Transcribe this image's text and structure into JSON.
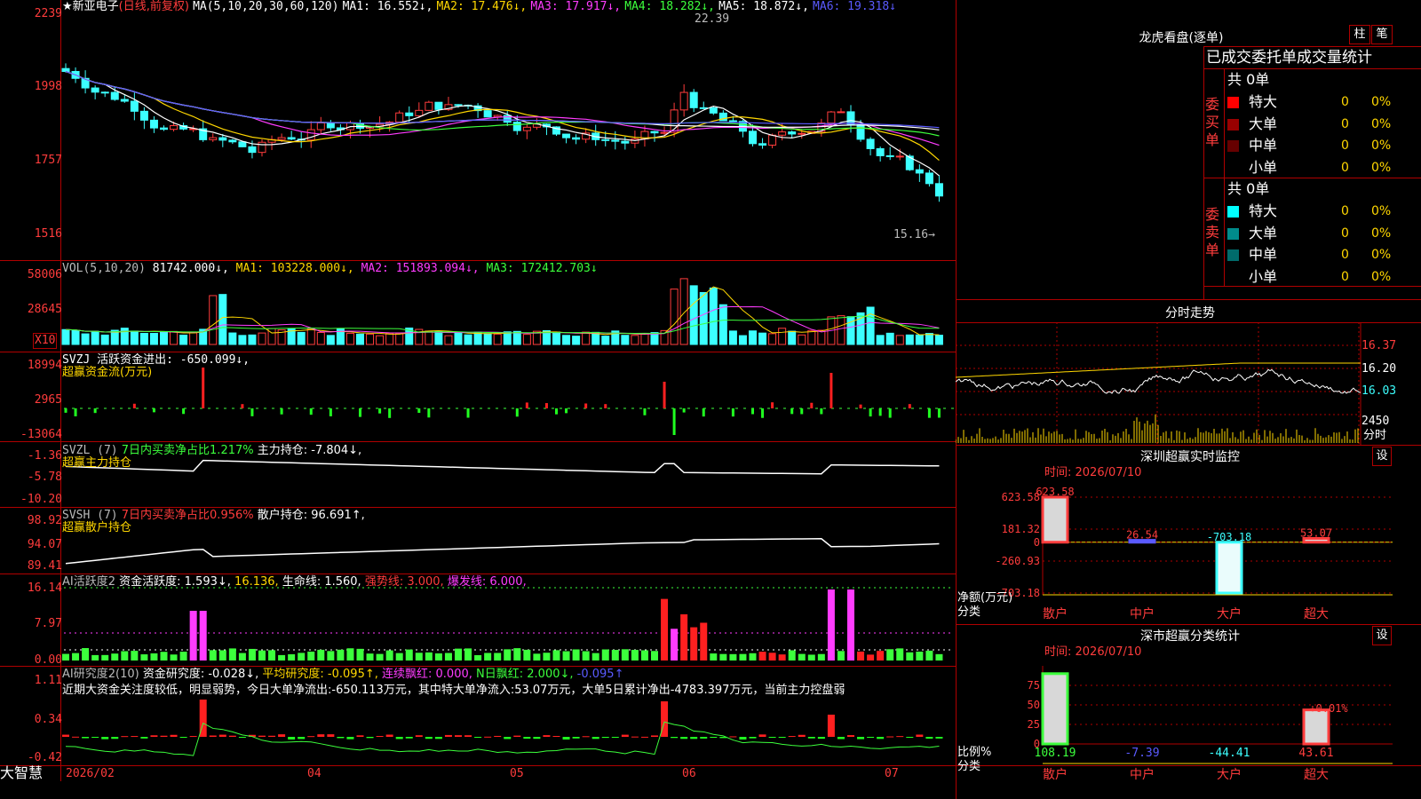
{
  "app": {
    "brand": "大智慧"
  },
  "kline": {
    "stock_name": "★新亚电子",
    "mode": "(日线,前复权)",
    "ma_header": "MA(5,10,20,30,60,120)",
    "ma1": "MA1: 16.552↓,",
    "ma2": "MA2: 17.476↓,",
    "ma3": "MA3: 17.917↓,",
    "ma4": "MA4: 18.282↓,",
    "ma5": "MA5: 18.872↓,",
    "ma6": "MA6: 19.318↓",
    "y_ticks": [
      "2239",
      "1998",
      "1757",
      "1516"
    ],
    "high_label": "22.39",
    "low_label": "15.16→"
  },
  "vol": {
    "header": "VOL(5,10,20)",
    "v": "81742.000↓,",
    "ma1": "MA1: 103228.000↓,",
    "ma2": "MA2: 151893.094↓,",
    "ma3": "MA3: 172412.703↓",
    "y_ticks": [
      "58006",
      "28645"
    ],
    "unit": "X10"
  },
  "svzj": {
    "header": "SVZJ  活跃资金进出: -650.099↓,",
    "sub": "超赢资金流(万元)",
    "y_ticks": [
      "18994",
      "2965",
      "-13064"
    ]
  },
  "svzl": {
    "header": "SVZL (7)",
    "desc": "7日内买卖净占比1.217%",
    "value": "主力持仓: -7.804↓,",
    "sub": "超赢主力持仓",
    "y_ticks": [
      "-1.36",
      "-5.78",
      "-10.20"
    ]
  },
  "svsh": {
    "header": "SVSH (7)",
    "desc": "7日内买卖净占比0.956%",
    "value": "散户持仓: 96.691↑,",
    "sub": "超赢散户持仓",
    "y_ticks": [
      "98.92",
      "94.07",
      "89.41"
    ]
  },
  "ai1": {
    "header": "AI活跃度2",
    "v1": "资金活跃度: 1.593↓,",
    "v2": "16.136,",
    "v3": "生命线: 1.560,",
    "v4": "强势线: 3.000,",
    "v5": "爆发线: 6.000,",
    "y_ticks": [
      "16.14",
      "7.97",
      "0.00"
    ]
  },
  "ai2": {
    "header": "AI研究度2(10)",
    "v1": "资金研究度: -0.028↓,",
    "v2": "平均研究度: -0.095↑,",
    "v3": "连续飘红: 0.000,",
    "v4": "N日飘红: 2.000↓,",
    "v5": "-0.095↑",
    "comment": "近期大资金关注度较低，明显弱势，今日大单净流出:-650.113万元，其中特大单净流入:53.07万元，大单5日累计净出-4783.397万元，当前主力控盘弱",
    "y_ticks": [
      "1.11",
      "0.34",
      "-0.42"
    ]
  },
  "xaxis": {
    "labels": [
      "2026/02",
      "04",
      "05",
      "06",
      "07"
    ]
  },
  "lhb": {
    "title": "龙虎看盘(逐单)",
    "btn1": "柱",
    "btn2": "笔",
    "subtitle": "已成交委托单成交量统计",
    "buy_label": "委买单",
    "sell_label": "委卖单",
    "buy_total": "共 0单",
    "sell_total": "共 0单",
    "buy_rows": [
      {
        "name": "特大",
        "count": "0",
        "pct": "0%",
        "color": "#ff0000"
      },
      {
        "name": "大单",
        "count": "0",
        "pct": "0%",
        "color": "#990000"
      },
      {
        "name": "中单",
        "count": "0",
        "pct": "0%",
        "color": "#660000"
      },
      {
        "name": "小单",
        "count": "0",
        "pct": "0%",
        "color": "#000000"
      }
    ],
    "sell_rows": [
      {
        "name": "特大",
        "count": "0",
        "pct": "0%",
        "color": "#00ffff"
      },
      {
        "name": "大单",
        "count": "0",
        "pct": "0%",
        "color": "#008b8b"
      },
      {
        "name": "中单",
        "count": "0",
        "pct": "0%",
        "color": "#006b6b"
      },
      {
        "name": "小单",
        "count": "0",
        "pct": "0%",
        "color": "#000000"
      }
    ]
  },
  "fenshi": {
    "title": "分时走势",
    "y_ticks": [
      "16.37",
      "16.20",
      "16.03"
    ],
    "vol_tick": "2450",
    "vol_unit": "分时"
  },
  "sz_monitor": {
    "title": "深圳超赢实时监控",
    "btn": "设",
    "time": "时间: 2026/07/10",
    "y_ticks": [
      "623.58",
      "181.32",
      "0",
      "-260.93",
      "-703.18"
    ],
    "y_axis_name": "净额(万元)",
    "x_axis_name": "分类",
    "categories": [
      "散户",
      "中户",
      "大户",
      "超大"
    ]
  },
  "sz_stats": {
    "title": "深市超赢分类统计",
    "btn": "设",
    "time": "时间: 2026/07/10",
    "y_ticks": [
      "75",
      "50",
      "25",
      "0"
    ],
    "top_label": "+0.01%",
    "y_axis_name": "比例%",
    "x_axis_name": "分类",
    "values_text": [
      "108.19",
      "-7.39",
      "-44.41",
      "43.61"
    ],
    "categories": [
      "散户",
      "中户",
      "大户",
      "超大"
    ]
  },
  "chart_data": [
    {
      "type": "bar",
      "title": "深圳超赢实时监控",
      "ylabel": "净额(万元)",
      "xlabel": "分类",
      "categories": [
        "散户",
        "中户",
        "大户",
        "超大"
      ],
      "values": [
        623.58,
        26.54,
        -703.18,
        53.07
      ],
      "ylim": [
        -703.18,
        623.58
      ]
    },
    {
      "type": "bar",
      "title": "深市超赢分类统计",
      "ylabel": "比例%",
      "xlabel": "分类",
      "categories": [
        "散户",
        "中户",
        "大户",
        "超大"
      ],
      "values": [
        108.19,
        -7.39,
        -44.41,
        43.61
      ],
      "ylim": [
        0,
        75
      ]
    }
  ]
}
